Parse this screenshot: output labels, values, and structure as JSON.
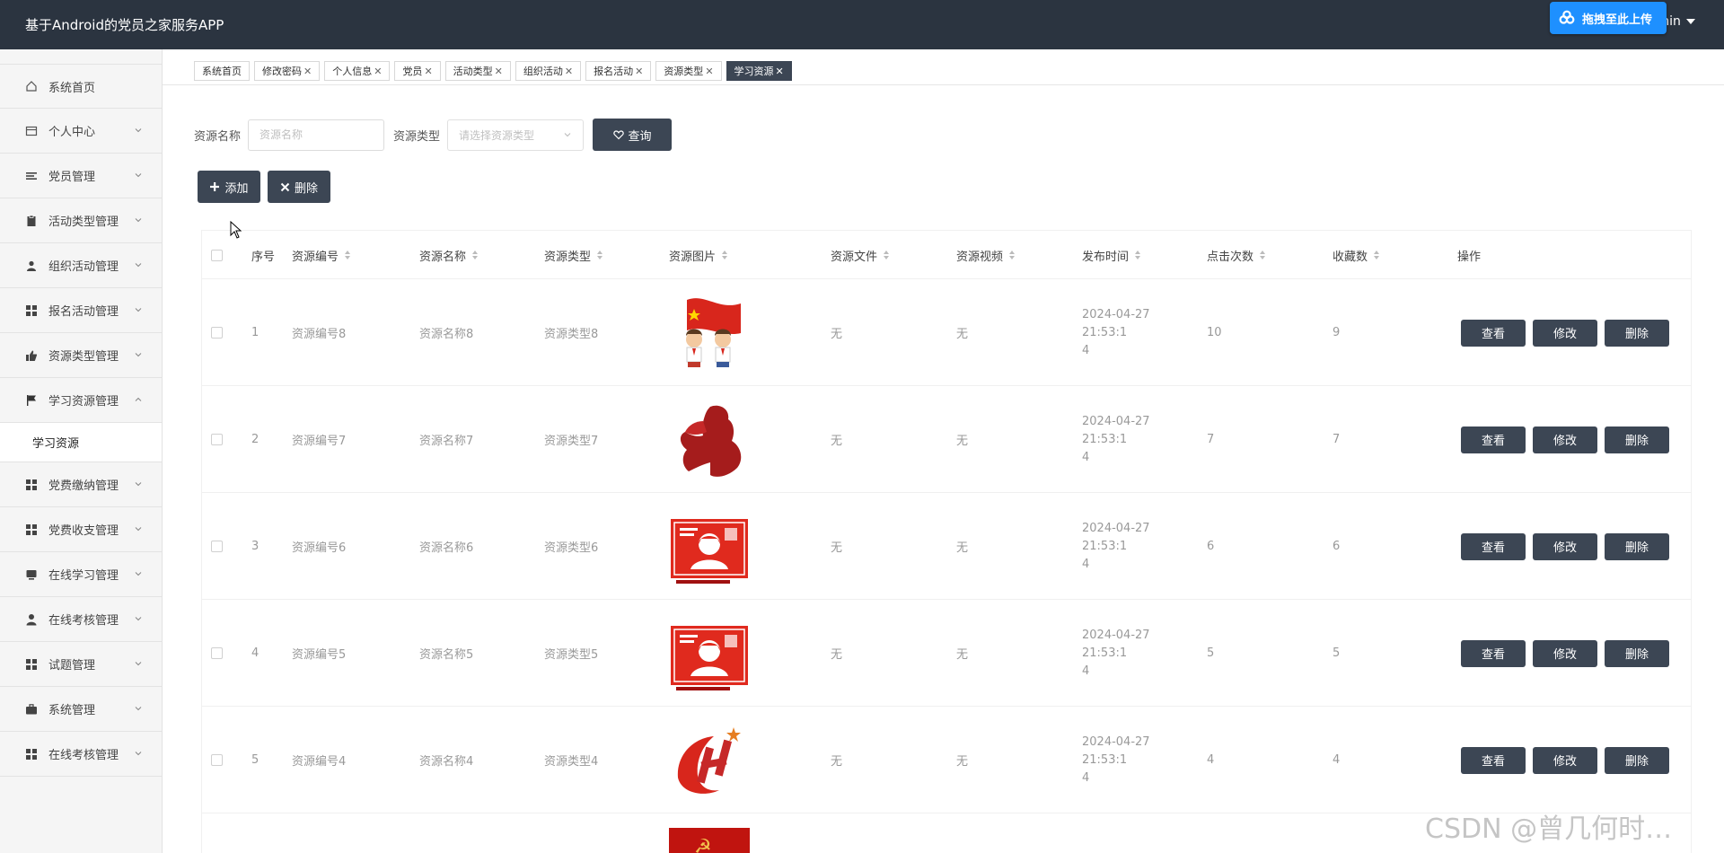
{
  "header": {
    "app_title": "基于Android的党员之家服务APP",
    "upload_label": "拖拽至此上传",
    "user_label": "admin"
  },
  "sidebar": {
    "items": [
      {
        "label": "系统首页",
        "icon": "home-icon",
        "expandable": false
      },
      {
        "label": "个人中心",
        "icon": "card-icon",
        "expandable": true
      },
      {
        "label": "党员管理",
        "icon": "list-icon",
        "expandable": true
      },
      {
        "label": "活动类型管理",
        "icon": "clipboard-icon",
        "expandable": true
      },
      {
        "label": "组织活动管理",
        "icon": "user-icon",
        "expandable": true
      },
      {
        "label": "报名活动管理",
        "icon": "grid-icon",
        "expandable": true
      },
      {
        "label": "资源类型管理",
        "icon": "thumb-icon",
        "expandable": true
      },
      {
        "label": "学习资源管理",
        "icon": "flag-icon",
        "expandable": true,
        "expanded": true
      },
      {
        "label": "党费缴纳管理",
        "icon": "grid-icon",
        "expandable": true
      },
      {
        "label": "党费收支管理",
        "icon": "grid-icon",
        "expandable": true
      },
      {
        "label": "在线学习管理",
        "icon": "monitor-icon",
        "expandable": true
      },
      {
        "label": "在线考核管理",
        "icon": "person-icon",
        "expandable": true
      },
      {
        "label": "试题管理",
        "icon": "grid-icon",
        "expandable": true
      },
      {
        "label": "系统管理",
        "icon": "briefcase-icon",
        "expandable": true
      },
      {
        "label": "在线考核管理",
        "icon": "grid-icon",
        "expandable": true
      }
    ],
    "submenu": {
      "label": "学习资源"
    }
  },
  "tabs": [
    {
      "label": "系统首页",
      "closable": false
    },
    {
      "label": "修改密码",
      "closable": true
    },
    {
      "label": "个人信息",
      "closable": true
    },
    {
      "label": "党员",
      "closable": true
    },
    {
      "label": "活动类型",
      "closable": true
    },
    {
      "label": "组织活动",
      "closable": true
    },
    {
      "label": "报名活动",
      "closable": true
    },
    {
      "label": "资源类型",
      "closable": true
    },
    {
      "label": "学习资源",
      "closable": true,
      "active": true
    }
  ],
  "search": {
    "name_label": "资源名称",
    "name_placeholder": "资源名称",
    "type_label": "资源类型",
    "type_placeholder": "请选择资源类型",
    "query_label": "查询"
  },
  "actions": {
    "add_label": "添加",
    "delete_label": "删除"
  },
  "table": {
    "headers": [
      "序号",
      "资源编号",
      "资源名称",
      "资源类型",
      "资源图片",
      "资源文件",
      "资源视频",
      "发布时间",
      "点击次数",
      "收藏数",
      "操作"
    ],
    "rows": [
      {
        "index": "1",
        "code": "资源编号8",
        "name": "资源名称8",
        "type": "资源类型8",
        "image": "two-children-flag",
        "file": "无",
        "video": "无",
        "time_line1": "2024-04-27 21:53:1",
        "time_line2": "4",
        "clicks": "10",
        "favorites": "9"
      },
      {
        "index": "2",
        "code": "资源编号7",
        "name": "资源名称7",
        "type": "资源类型7",
        "image": "saluting-silhouette",
        "file": "无",
        "video": "无",
        "time_line1": "2024-04-27 21:53:1",
        "time_line2": "4",
        "clicks": "7",
        "favorites": "7"
      },
      {
        "index": "3",
        "code": "资源编号6",
        "name": "资源名称6",
        "type": "资源类型6",
        "image": "red-poster-soldier",
        "file": "无",
        "video": "无",
        "time_line1": "2024-04-27 21:53:1",
        "time_line2": "4",
        "clicks": "6",
        "favorites": "6"
      },
      {
        "index": "4",
        "code": "资源编号5",
        "name": "资源名称5",
        "type": "资源类型5",
        "image": "red-poster-soldier",
        "file": "无",
        "video": "无",
        "time_line1": "2024-04-27 21:53:1",
        "time_line2": "4",
        "clicks": "5",
        "favorites": "5"
      },
      {
        "index": "5",
        "code": "资源编号4",
        "name": "资源名称4",
        "type": "资源类型4",
        "image": "party-emblem-logo",
        "file": "无",
        "video": "无",
        "time_line1": "2024-04-27 21:53:1",
        "time_line2": "4",
        "clicks": "4",
        "favorites": "4"
      }
    ],
    "row_actions": {
      "view": "查看",
      "edit": "修改",
      "delete": "删除"
    }
  },
  "watermark": "CSDN @曾几何时…",
  "colors": {
    "header_bg": "#2b3440",
    "button_dark": "#3c4654",
    "upload_blue": "#1e90ff",
    "accent_red": "#d8261c"
  }
}
